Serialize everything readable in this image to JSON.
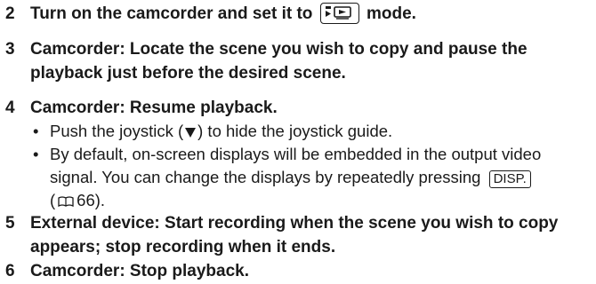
{
  "steps": [
    {
      "number": "2",
      "text_before": "Turn on the camcorder and set it to",
      "mode_icon": "playback-mode-icon",
      "text_after": "mode."
    },
    {
      "number": "3",
      "line1": "Camcorder: Locate the scene you wish to copy and pause the",
      "line2": "playback just before the desired scene."
    },
    {
      "number": "4",
      "text": "Camcorder: Resume playback.",
      "bullets": [
        {
          "text_before": "Push the joystick (",
          "icon": "down-triangle-icon",
          "text_after": ") to hide the joystick guide."
        },
        {
          "line1": "By default, on-screen displays will be embedded in the output video",
          "line2_before": "signal. You can change the displays by repeatedly pressing",
          "button_label": "DISP.",
          "line3_open": "(",
          "ref_icon": "book-icon",
          "line3_page": "66)."
        }
      ]
    },
    {
      "number": "5",
      "line1": "External device: Start recording when the scene you wish to copy",
      "line2": "appears; stop recording when it ends."
    },
    {
      "number": "6",
      "text": "Camcorder: Stop playback."
    }
  ]
}
